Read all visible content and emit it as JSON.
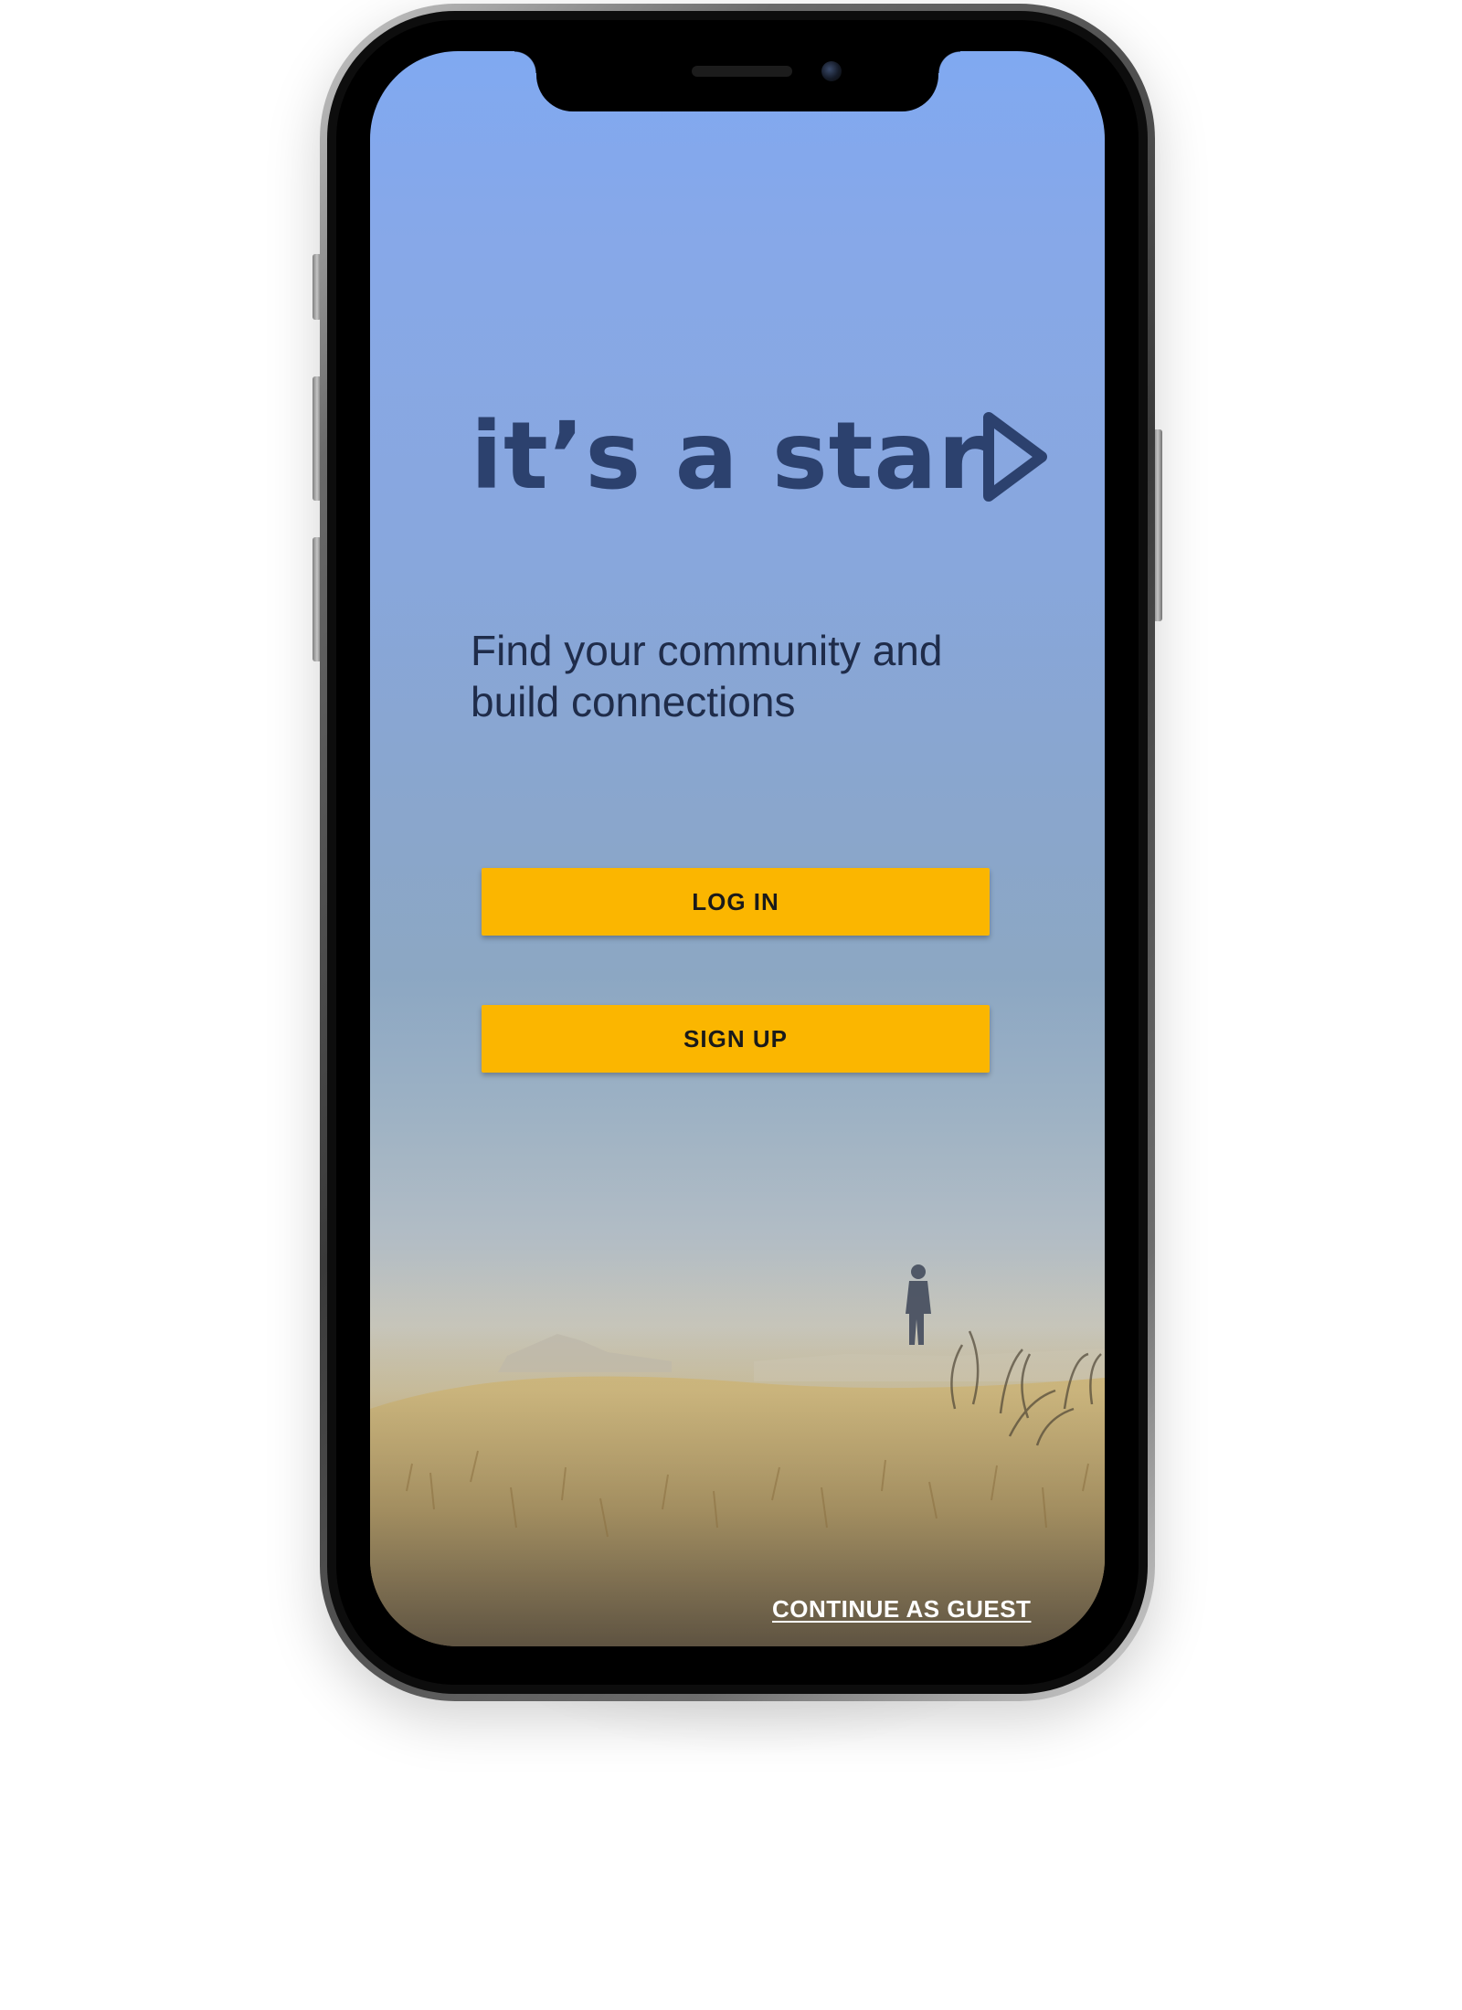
{
  "app": {
    "logo_text": "it’s a star",
    "logo_icon": "play-arrow-icon",
    "tagline": "Find your community and build connections"
  },
  "actions": {
    "login_label": "LOG IN",
    "signup_label": "SIGN UP",
    "guest_label": "CONTINUE AS GUEST"
  },
  "colors": {
    "brand_text": "#2c416e",
    "button": "#fbb600",
    "sky_top": "#80a9f1"
  }
}
